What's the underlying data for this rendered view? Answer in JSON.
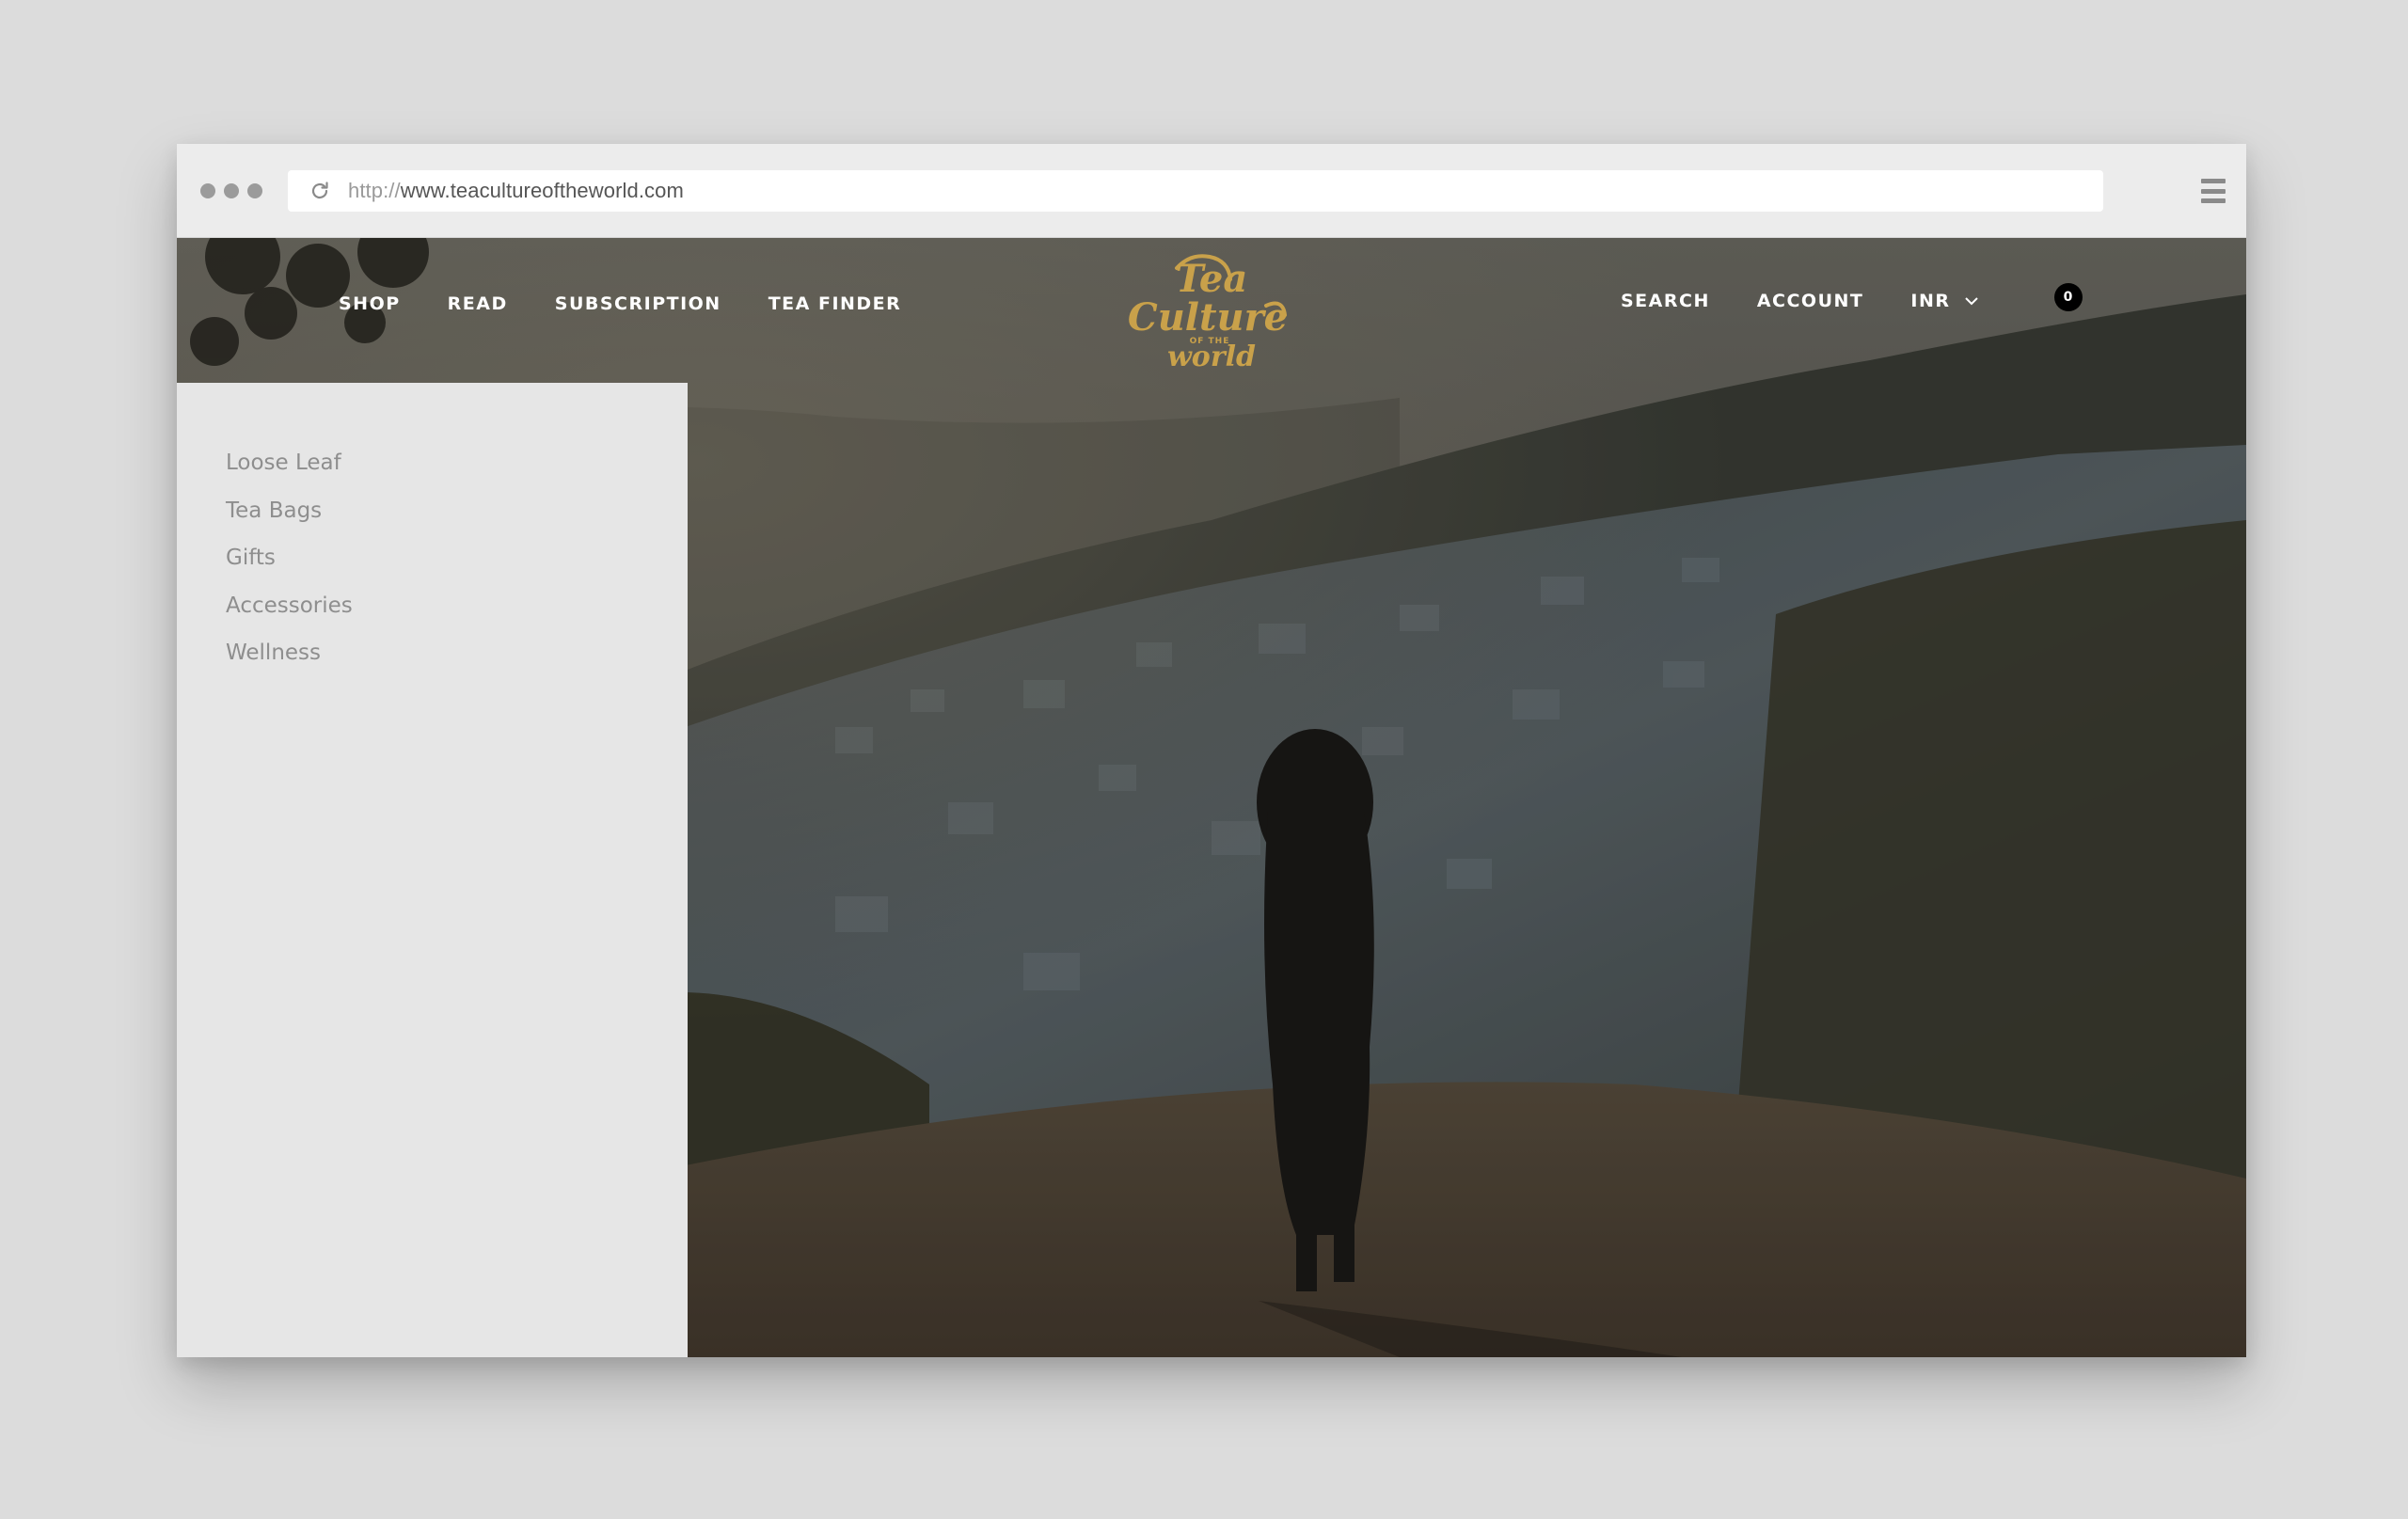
{
  "browser": {
    "url_protocol": "http://",
    "url_host": "www.teacultureoftheworld.com"
  },
  "nav": {
    "left": [
      "SHOP",
      "READ",
      "SUBSCRIPTION",
      "TEA FINDER"
    ],
    "search": "SEARCH",
    "account": "ACCOUNT",
    "currency": "INR",
    "cart_count": "0"
  },
  "logo": {
    "line1": "Tea",
    "line2": "Culture",
    "line3": "OF THE",
    "line4": "world",
    "color": "#c9a14a"
  },
  "shop_menu": {
    "items": [
      "Loose Leaf",
      "Tea Bags",
      "Gifts",
      "Accessories",
      "Wellness"
    ]
  }
}
